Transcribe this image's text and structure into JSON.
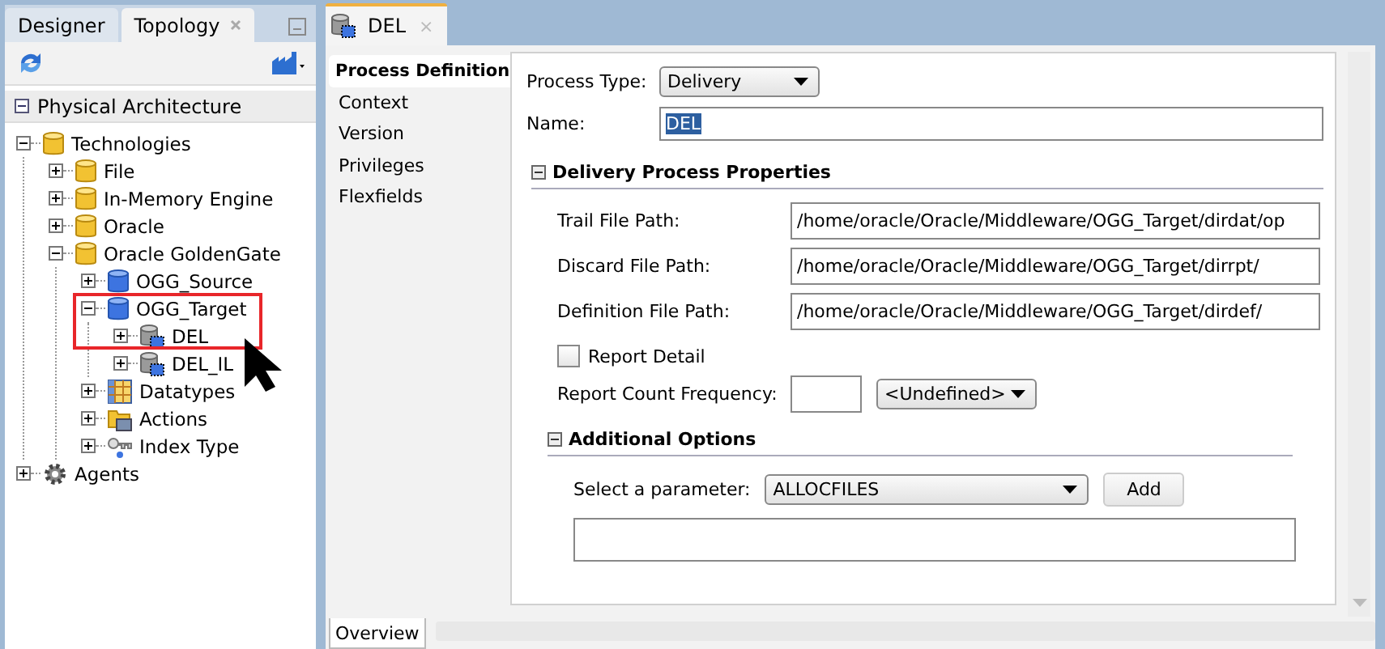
{
  "left_panel": {
    "tabs": [
      {
        "label": "Designer",
        "selected": false
      },
      {
        "label": "Topology",
        "selected": true
      }
    ],
    "section": {
      "title": "Physical Architecture",
      "expanded": true
    },
    "tree": [
      {
        "label": "Technologies",
        "kind": "yellow-db",
        "expanded": true,
        "children": [
          {
            "label": "File",
            "kind": "yellow-db",
            "expanded": false
          },
          {
            "label": "In-Memory Engine",
            "kind": "yellow-db",
            "expanded": false
          },
          {
            "label": "Oracle",
            "kind": "yellow-db",
            "expanded": false
          },
          {
            "label": "Oracle GoldenGate",
            "kind": "yellow-db",
            "expanded": true,
            "children": [
              {
                "label": "OGG_Source",
                "kind": "blue-db",
                "expanded": false
              },
              {
                "label": "OGG_Target",
                "kind": "blue-db",
                "expanded": true,
                "children": [
                  {
                    "label": "DEL",
                    "kind": "process",
                    "expanded": false
                  },
                  {
                    "label": "DEL_IL",
                    "kind": "process",
                    "expanded": false
                  }
                ]
              },
              {
                "label": "Datatypes",
                "kind": "grid",
                "expanded": false
              },
              {
                "label": "Actions",
                "kind": "folder",
                "expanded": false
              },
              {
                "label": "Index Type",
                "kind": "key",
                "expanded": false
              }
            ]
          }
        ]
      },
      {
        "label": "Agents",
        "kind": "gear",
        "expanded": false
      }
    ]
  },
  "editor": {
    "tab": {
      "label": "DEL",
      "close": "×"
    },
    "nav": [
      {
        "label": "Process Definition",
        "selected": true
      },
      {
        "label": "Context",
        "selected": false
      },
      {
        "label": "Version",
        "selected": false
      },
      {
        "label": "Privileges",
        "selected": false
      },
      {
        "label": "Flexfields",
        "selected": false
      }
    ],
    "process_type": {
      "label": "Process Type:",
      "value": "Delivery"
    },
    "name": {
      "label": "Name:",
      "value": "DEL",
      "text_selected": true
    },
    "delivery_section": {
      "title": "Delivery Process Properties",
      "expanded": true,
      "fields": [
        {
          "label": "Trail File Path:",
          "value": "/home/oracle/Oracle/Middleware/OGG_Target/dirdat/op"
        },
        {
          "label": "Discard File Path:",
          "value": "/home/oracle/Oracle/Middleware/OGG_Target/dirrpt/"
        },
        {
          "label": "Definition File Path:",
          "value": "/home/oracle/Oracle/Middleware/OGG_Target/dirdef/"
        }
      ]
    },
    "report_detail": {
      "label": "Report Detail",
      "checked": false
    },
    "report_count": {
      "label": "Report Count Frequency:",
      "unit": "<Undefined>"
    },
    "additional_options": {
      "title": "Additional Options",
      "expanded": true,
      "parameter_label": "Select a parameter:",
      "parameter_value": "ALLOCFILES",
      "add_button": "Add"
    },
    "bottom_tabs": [
      {
        "label": "Overview",
        "selected": true
      }
    ]
  }
}
